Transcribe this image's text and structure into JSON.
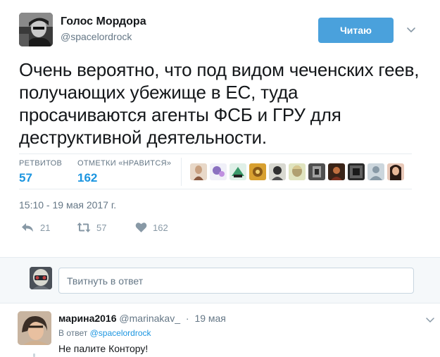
{
  "tweet": {
    "author_name": "Голос Мордора",
    "author_handle": "@spacelordrock",
    "follow_button_label": "Читаю",
    "text": "Очень вероятно, что под видом чеченских геев, получающих убежище в ЕС, туда просачиваются агенты ФСБ и ГРУ для деструктивной деятельности.",
    "stats": {
      "retweets_label": "РЕТВИТОВ",
      "retweets_value": "57",
      "likes_label": "ОТМЕТКИ «НРАВИТСЯ»",
      "likes_value": "162"
    },
    "timestamp": "15:10 - 19 мая 2017 г.",
    "actions": {
      "reply_count": "21",
      "retweet_count": "57",
      "like_count": "162"
    }
  },
  "reply_box": {
    "placeholder": "Твитнуть в ответ"
  },
  "reply": {
    "author_name": "марина2016",
    "author_handle": "@marinakav_",
    "separator": "·",
    "time": "19 мая",
    "reply_to_prefix": "В ответ",
    "reply_to_handle": "@spacelordrock",
    "text": "Не палите Контору!"
  },
  "colors": {
    "accent": "#1b95e0",
    "follow_button": "#4aa1dc",
    "muted_text": "#657786",
    "action_icon": "#8899a6",
    "reply_bg": "#f5f8fa"
  },
  "icons": {
    "caret": "chevron-down-icon",
    "reply": "reply-icon",
    "retweet": "retweet-icon",
    "like": "heart-icon"
  }
}
